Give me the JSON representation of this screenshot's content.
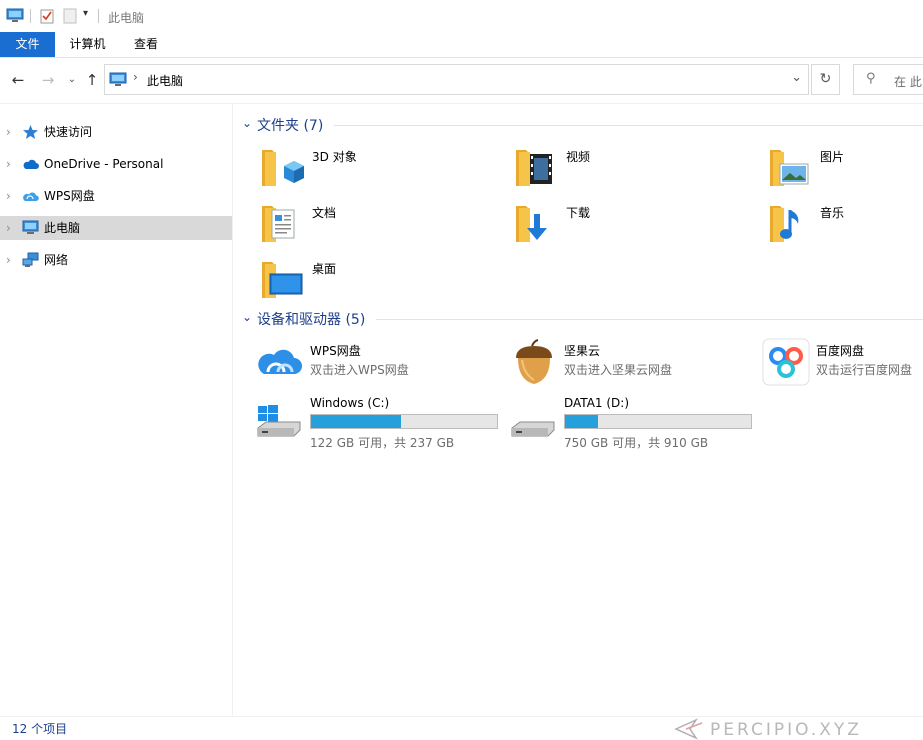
{
  "window": {
    "title": "此电脑"
  },
  "ribbon": {
    "tabs": [
      "文件",
      "计算机",
      "查看"
    ]
  },
  "address": {
    "location": "此电脑"
  },
  "search": {
    "placeholder": "在 此"
  },
  "sidebar": {
    "items": [
      {
        "label": "快速访问",
        "icon": "star-icon",
        "selected": false
      },
      {
        "label": "OneDrive - Personal",
        "icon": "cloud-icon",
        "selected": false
      },
      {
        "label": "WPS网盘",
        "icon": "wps-cloud-icon",
        "selected": false
      },
      {
        "label": "此电脑",
        "icon": "computer-icon",
        "selected": true
      },
      {
        "label": "网络",
        "icon": "network-icon",
        "selected": false
      }
    ]
  },
  "folders": {
    "title": "文件夹 (7)",
    "items": [
      {
        "name": "3D 对象",
        "icon": "3d-objects-folder-icon"
      },
      {
        "name": "视频",
        "icon": "videos-folder-icon"
      },
      {
        "name": "图片",
        "icon": "pictures-folder-icon"
      },
      {
        "name": "文档",
        "icon": "documents-folder-icon"
      },
      {
        "name": "下载",
        "icon": "downloads-folder-icon"
      },
      {
        "name": "音乐",
        "icon": "music-folder-icon"
      },
      {
        "name": "桌面",
        "icon": "desktop-folder-icon"
      }
    ]
  },
  "devices": {
    "title": "设备和驱动器 (5)",
    "apps": [
      {
        "name": "WPS网盘",
        "subtitle": "双击进入WPS网盘",
        "icon": "wps-cloud-icon"
      },
      {
        "name": "坚果云",
        "subtitle": "双击进入坚果云网盘",
        "icon": "jianguoyun-icon"
      },
      {
        "name": "百度网盘",
        "subtitle": "双击运行百度网盘",
        "icon": "baidu-netdisk-icon"
      }
    ],
    "drives": [
      {
        "name": "Windows (C:)",
        "space": "122 GB 可用，共 237 GB",
        "used_fraction": 0.485,
        "icon": "windows-drive-icon"
      },
      {
        "name": "DATA1 (D:)",
        "space": "750 GB 可用，共 910 GB",
        "used_fraction": 0.176,
        "icon": "drive-icon"
      }
    ]
  },
  "status": {
    "count": "12 个项目"
  },
  "watermark": {
    "text": "PERCIPIO.XYZ"
  },
  "colors": {
    "accent": "#1a6dd1",
    "group_title": "#1e3f8c",
    "drive_fill": "#26a0da",
    "folder": "#f7c44a"
  }
}
